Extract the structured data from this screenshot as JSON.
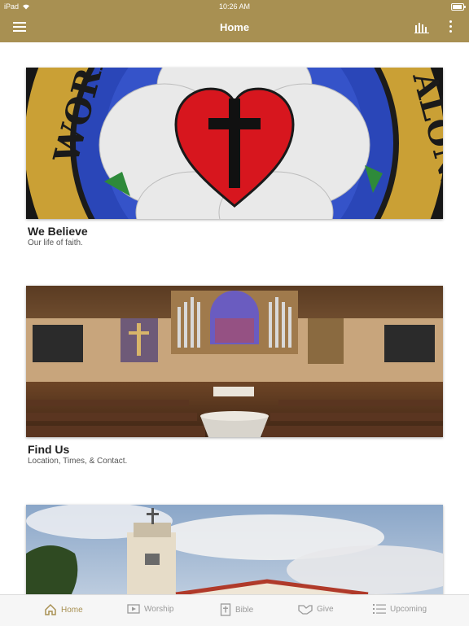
{
  "status_bar": {
    "device": "iPad",
    "time": "10:26 AM"
  },
  "nav": {
    "title": "Home"
  },
  "cards": [
    {
      "title": "We Believe",
      "subtitle": "Our life of faith.",
      "image_text_left": "WORD",
      "image_text_right": "ALONE"
    },
    {
      "title": "Find Us",
      "subtitle": "Location, Times, & Contact."
    },
    {
      "title": "",
      "subtitle": ""
    }
  ],
  "tabs": [
    {
      "label": "Home",
      "icon": "home-icon",
      "active": true
    },
    {
      "label": "Worship",
      "icon": "video-icon",
      "active": false
    },
    {
      "label": "Bible",
      "icon": "bible-icon",
      "active": false
    },
    {
      "label": "Give",
      "icon": "give-icon",
      "active": false
    },
    {
      "label": "Upcoming",
      "icon": "list-icon",
      "active": false
    }
  ],
  "colors": {
    "accent": "#a89052",
    "tab_inactive": "#9a9a9a",
    "background": "#ffffff"
  }
}
